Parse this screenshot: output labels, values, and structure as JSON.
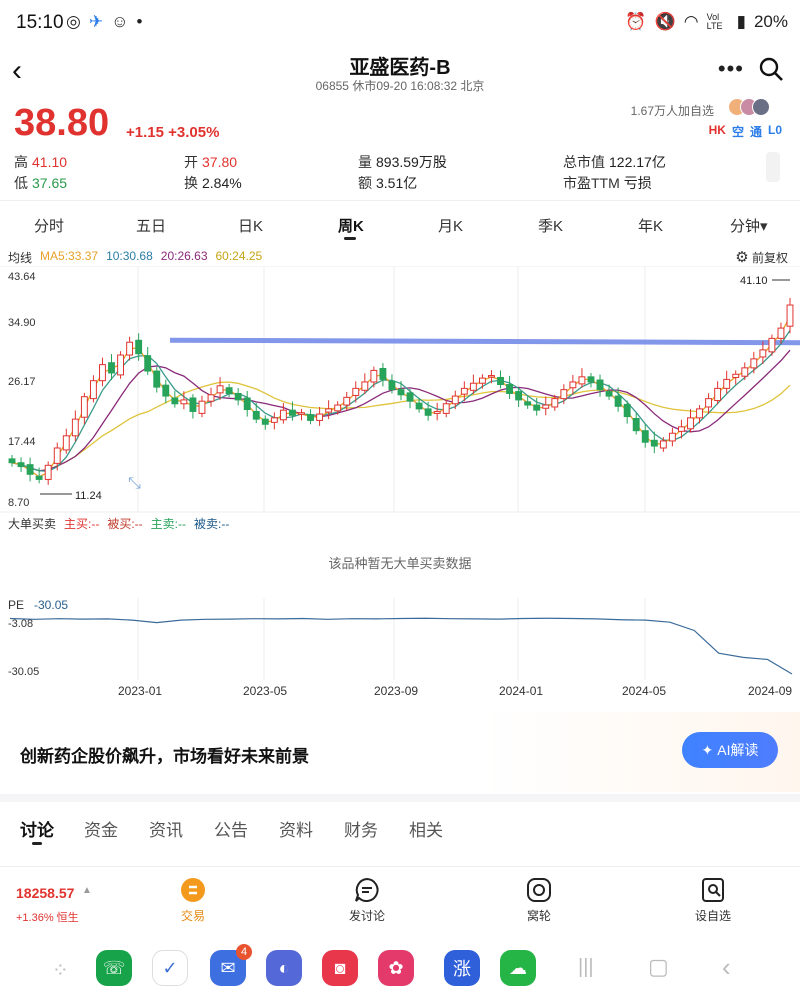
{
  "status_bar": {
    "time": "15:10",
    "battery": "20%",
    "network": "Vol LTE"
  },
  "header": {
    "title": "亚盛医药-B",
    "subtitle": "06855 休市09-20 16:08:32 北京"
  },
  "quote": {
    "price": "38.80",
    "change": "+1.15 +3.05%",
    "watchers": "1.67万人加自选",
    "tags": [
      "HK",
      "空",
      "通",
      "L0"
    ],
    "stats": [
      {
        "label": "高",
        "value": "41.10",
        "tone": "red"
      },
      {
        "label": "开",
        "value": "37.80",
        "tone": "red"
      },
      {
        "label": "量",
        "value": "893.59万股",
        "tone": "plain"
      },
      {
        "label": "总市值",
        "value": "122.17亿",
        "tone": "plain"
      },
      {
        "label": "低",
        "value": "37.65",
        "tone": "green"
      },
      {
        "label": "换",
        "value": "2.84%",
        "tone": "plain"
      },
      {
        "label": "额",
        "value": "3.51亿",
        "tone": "plain"
      },
      {
        "label": "市盈TTM",
        "value": "亏损",
        "tone": "plain"
      }
    ]
  },
  "period_tabs": [
    "分时",
    "五日",
    "日K",
    "周K",
    "月K",
    "季K",
    "年K",
    "分钟▾"
  ],
  "active_period": "周K",
  "ma_row": {
    "label": "均线",
    "ma5": "MA5:33.37",
    "ma10": "10:30.68",
    "ma20": "20:26.63",
    "ma60": "60:24.25",
    "adjust": "前复权"
  },
  "colors": {
    "up": "#e0332f",
    "down": "#27a35a",
    "ma5": "#e6a12a",
    "ma10": "#3a9a8c",
    "ma20": "#8a2a7a",
    "ma60": "#dfc33a",
    "trendline": "#6c84e6",
    "pe_line": "#3b6b9a"
  },
  "chart_data": {
    "type": "line",
    "title": "",
    "y_ticks": [
      "43.64",
      "34.90",
      "26.17",
      "17.44",
      "8.70"
    ],
    "ylim": [
      8.7,
      43.64
    ],
    "x_labels": [
      "2023-01",
      "2023-05",
      "2023-09",
      "2024-01",
      "2024-05",
      "2024-09"
    ],
    "annotations": {
      "high": "41.10",
      "low": "11.24"
    },
    "trendline_level": 33.0,
    "weekly_close": [
      14.2,
      13.6,
      12.4,
      11.6,
      13.8,
      16.5,
      18.4,
      21.0,
      24.5,
      27.0,
      29.5,
      28.2,
      31.0,
      33.0,
      31.2,
      28.5,
      26.0,
      24.6,
      23.4,
      24.0,
      22.2,
      23.8,
      24.8,
      26.2,
      25.0,
      24.0,
      22.5,
      21.0,
      20.2,
      21.2,
      22.4,
      21.6,
      22.0,
      20.8,
      21.8,
      22.6,
      23.2,
      24.4,
      25.8,
      26.8,
      28.6,
      27.2,
      25.6,
      24.8,
      23.8,
      22.6,
      21.6,
      22.2,
      23.4,
      24.6,
      25.8,
      26.6,
      27.4,
      27.8,
      26.4,
      25.0,
      24.0,
      23.2,
      22.4,
      23.2,
      24.2,
      25.6,
      26.8,
      27.6,
      26.8,
      25.6,
      24.6,
      23.0,
      21.4,
      19.2,
      17.4,
      16.8,
      17.6,
      18.8,
      19.8,
      21.2,
      22.6,
      24.2,
      25.8,
      27.2,
      28.0,
      29.0,
      30.4,
      31.8,
      33.6,
      35.2,
      38.8
    ],
    "ma_series_last": {
      "MA5": 33.37,
      "MA10": 30.68,
      "MA20": 26.63,
      "MA60": 24.25
    }
  },
  "big_orders": {
    "title": "大单买卖",
    "buy": "主买:--",
    "passive_buy": "被买:--",
    "sell": "主卖:--",
    "passive_sell": "被卖:--",
    "empty": "该品种暂无大单买卖数据"
  },
  "pe": {
    "label": "PE",
    "value": "-30.05",
    "ticks": [
      "-3.08",
      "-30.05"
    ],
    "series": [
      -3.2,
      -3.6,
      -3.3,
      -3.5,
      -3.4,
      -4.0,
      -5.2,
      -4.0,
      -3.6,
      -3.5,
      -3.3,
      -3.4,
      -3.2,
      -3.6,
      -3.3,
      -3.4,
      -3.2,
      -3.1,
      -3.3,
      -3.4,
      -3.5,
      -3.2,
      -3.1,
      -3.2,
      -3.4,
      -3.8,
      -4.0,
      -5.0,
      -9.0,
      -20.0,
      -22.0,
      -23.0,
      -30.05
    ]
  },
  "ai_banner": {
    "text": "创新药企股价飙升，市场看好未来前景",
    "button": "AI解读"
  },
  "news_tabs": [
    "讨论",
    "资金",
    "资讯",
    "公告",
    "资料",
    "财务",
    "相关"
  ],
  "bottom_nav": {
    "index_value": "18258.57",
    "index_change": "+1.36% 恒生",
    "items": [
      "交易",
      "发讨论",
      "窝轮",
      "设自选"
    ]
  },
  "dock": {
    "badge": "4"
  }
}
